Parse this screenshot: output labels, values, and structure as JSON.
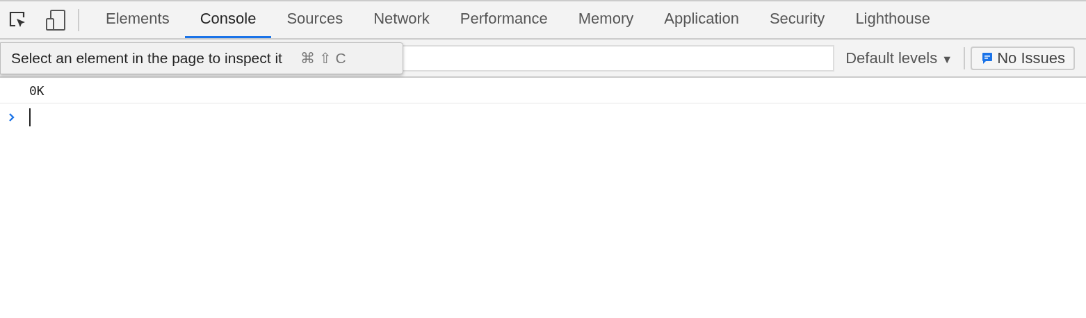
{
  "tabs": [
    {
      "label": "Elements",
      "selected": false
    },
    {
      "label": "Console",
      "selected": true
    },
    {
      "label": "Sources",
      "selected": false
    },
    {
      "label": "Network",
      "selected": false
    },
    {
      "label": "Performance",
      "selected": false
    },
    {
      "label": "Memory",
      "selected": false
    },
    {
      "label": "Application",
      "selected": false
    },
    {
      "label": "Security",
      "selected": false
    },
    {
      "label": "Lighthouse",
      "selected": false
    }
  ],
  "tooltip": {
    "text": "Select an element in the page to inspect it",
    "shortcut": "⌘ ⇧ C"
  },
  "levels": {
    "label": "Default levels",
    "arrow": "▼"
  },
  "issues": {
    "label": "No Issues"
  },
  "console_lines": [
    "0K"
  ]
}
